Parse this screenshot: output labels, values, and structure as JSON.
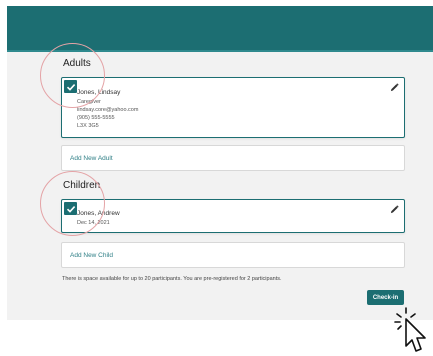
{
  "header": {
    "color": "#1c6e72"
  },
  "adults": {
    "title": "Adults",
    "members": [
      {
        "name": "Jones, Lindsay",
        "details": [
          "Caregiver",
          "lindsay.core@yahoo.com",
          "(905) 555-5555",
          "L3X 3G5"
        ],
        "checked": true
      }
    ],
    "add_label": "Add New Adult"
  },
  "children": {
    "title": "Children",
    "members": [
      {
        "name": "Jones, Andrew",
        "details": [
          "Dec 14, 2021"
        ],
        "checked": true
      }
    ],
    "add_label": "Add New Child"
  },
  "notice": "There is space available for up to 20 participants. You are pre-registered for 2 participants.",
  "actions": {
    "checkin_label": "Check-in"
  },
  "icons": {
    "checkbox": "checkmark-icon",
    "edit": "pencil-icon",
    "cursor": "pointer-cursor-icon"
  },
  "colors": {
    "accent": "#1c6e72",
    "highlight_circle": "#e4a3a6",
    "link": "#2f7f86"
  }
}
